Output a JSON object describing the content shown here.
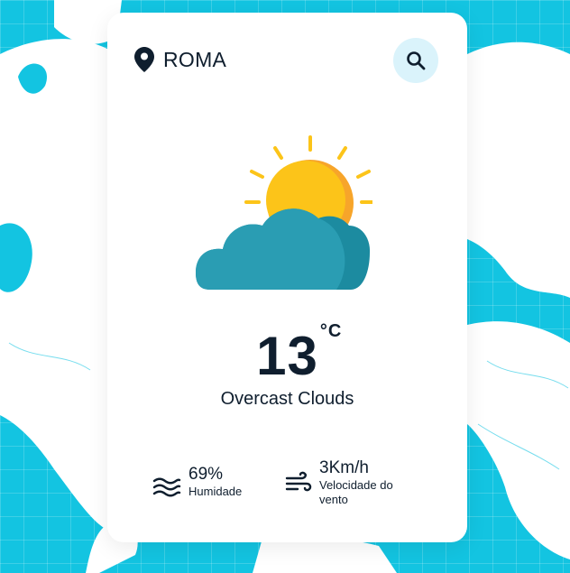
{
  "location": {
    "icon": "map-pin-icon",
    "city": "ROMA"
  },
  "search": {
    "icon": "search-icon"
  },
  "weather": {
    "icon": "sun-behind-cloud-icon",
    "temperature": "13",
    "unit": "°C",
    "description": "Overcast Clouds"
  },
  "humidity": {
    "icon": "waves-icon",
    "value": "69%",
    "label": "Humidade"
  },
  "wind": {
    "icon": "wind-icon",
    "value": "3Km/h",
    "label": "Velocidade do vento"
  },
  "colors": {
    "background": "#13c4e1",
    "card": "#ffffff",
    "text": "#0f1e2e",
    "search_button": "#daf3fb",
    "sun": "#fcc419",
    "sun_shade": "#f7a52a",
    "cloud": "#2a9db3",
    "cloud_shade": "#1c8ba0"
  }
}
